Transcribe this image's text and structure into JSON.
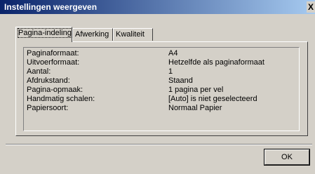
{
  "window": {
    "title": "Instellingen weergeven",
    "close_label": "X"
  },
  "tabs": [
    {
      "label": "Pagina-indeling",
      "active": true
    },
    {
      "label": "Afwerking",
      "active": false
    },
    {
      "label": "Kwaliteit",
      "active": false
    }
  ],
  "settings": [
    {
      "key": "Paginaformaat:",
      "value": "A4"
    },
    {
      "key": "Uitvoerformaat:",
      "value": "Hetzelfde als paginaformaat"
    },
    {
      "key": "Aantal:",
      "value": "1"
    },
    {
      "key": "Afdrukstand:",
      "value": "Staand"
    },
    {
      "key": "Pagina-opmaak:",
      "value": "1 pagina per vel"
    },
    {
      "key": "Handmatig schalen:",
      "value": "[Auto] is niet geselecteerd"
    },
    {
      "key": "Papiersoort:",
      "value": "Normaal Papier"
    }
  ],
  "buttons": {
    "ok": "OK"
  }
}
